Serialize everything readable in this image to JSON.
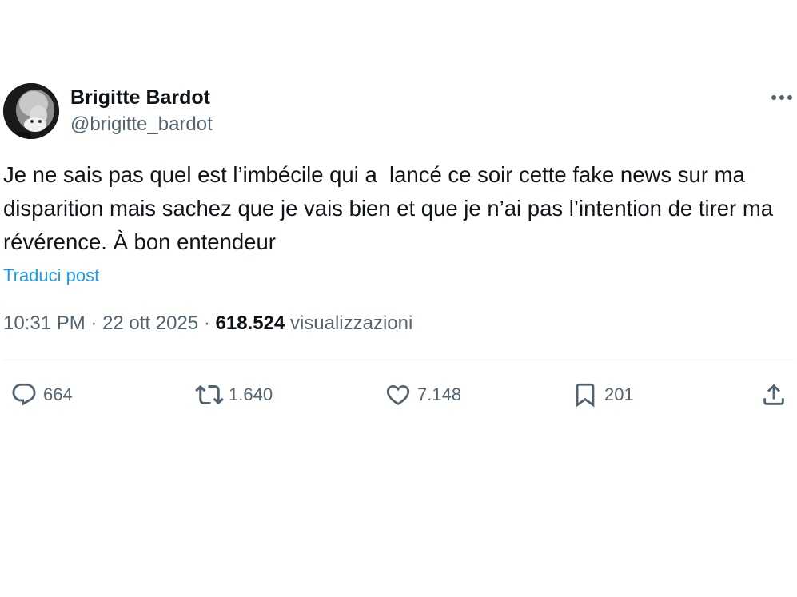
{
  "author": {
    "name": "Brigitte Bardot",
    "handle": "@brigitte_bardot"
  },
  "post": {
    "text": "Je ne sais pas quel est l’imbécile qui a  lancé ce soir cette fake news sur ma disparition mais sachez que je vais bien et que je n’ai pas l’intention de tirer ma révérence. À bon entendeur",
    "translate_label": "Traduci post"
  },
  "meta": {
    "time": "10:31 PM",
    "separator": " · ",
    "date": "22 ott 2025",
    "views_count": "618.524",
    "views_label": "visualizzazioni"
  },
  "actions": {
    "replies": "664",
    "reposts": "1.640",
    "likes": "7.148",
    "bookmarks": "201"
  },
  "icons": {
    "more": "more-horizontal-icon",
    "reply": "reply-bubble-icon",
    "repost": "repost-arrows-icon",
    "like": "heart-icon",
    "bookmark": "bookmark-icon",
    "share": "share-upload-icon"
  },
  "colors": {
    "text": "#0f1419",
    "secondary": "#536471",
    "link": "#1d9bf0",
    "divider": "#eff3f4"
  }
}
